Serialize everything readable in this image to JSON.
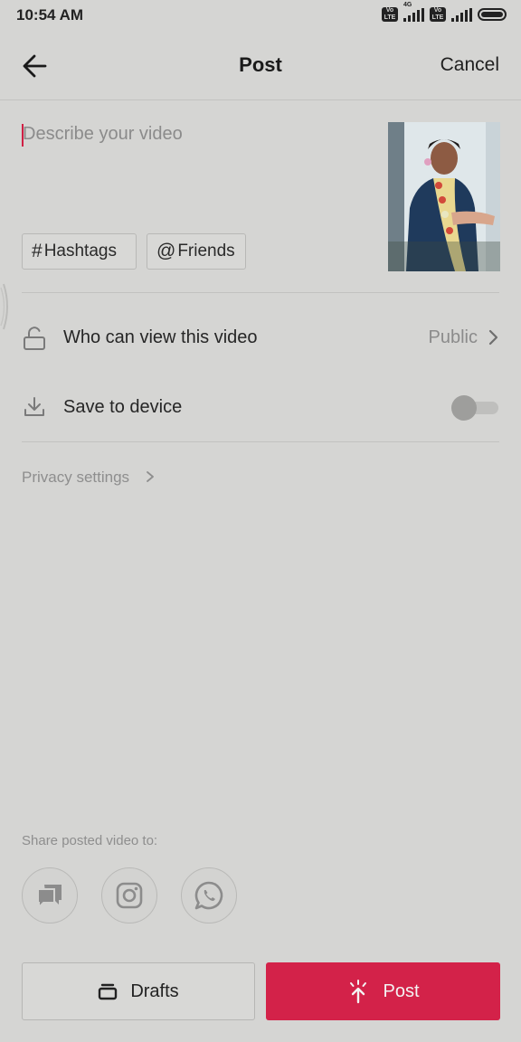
{
  "status_bar": {
    "time": "10:54 AM",
    "sim_badge": "Vo LTE",
    "network_type": "4G"
  },
  "header": {
    "title": "Post",
    "cancel_label": "Cancel"
  },
  "caption": {
    "placeholder": "Describe your video"
  },
  "tags": {
    "hashtags_label": "Hashtags",
    "hashtags_symbol": "#",
    "friends_label": "Friends",
    "friends_symbol": "@"
  },
  "settings": {
    "who_can_view_label": "Who can view this video",
    "who_can_view_value": "Public",
    "save_to_device_label": "Save to device",
    "save_to_device_on": false,
    "privacy_label": "Privacy settings"
  },
  "share": {
    "label": "Share posted video to:",
    "targets": [
      "message-icon",
      "instagram-icon",
      "whatsapp-icon"
    ]
  },
  "footer": {
    "drafts_label": "Drafts",
    "post_label": "Post"
  },
  "colors": {
    "accent": "#d32249",
    "background": "#d5d5d3"
  }
}
